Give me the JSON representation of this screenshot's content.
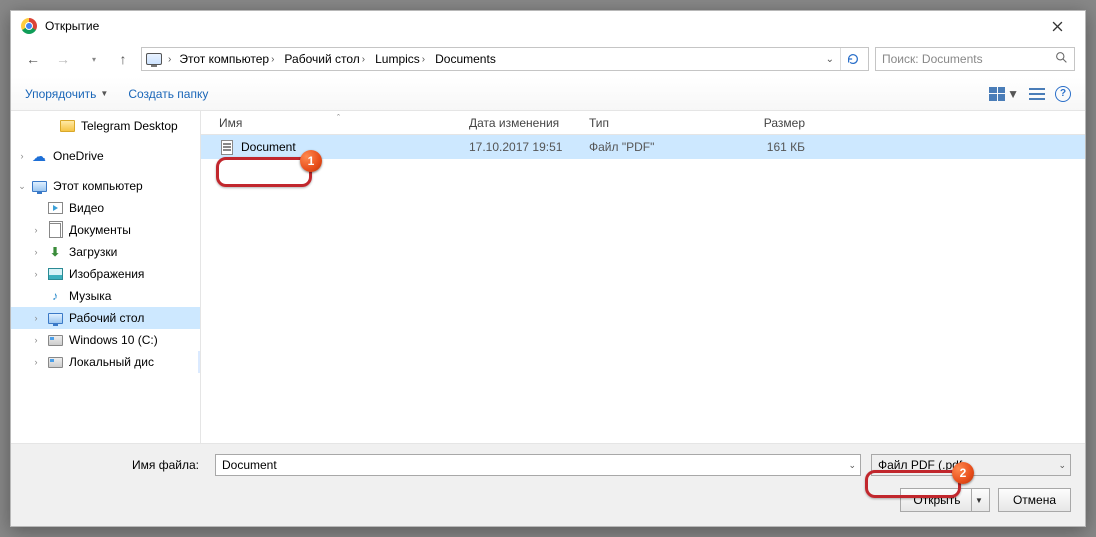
{
  "window": {
    "title": "Открытие"
  },
  "nav": {
    "crumbs": [
      "Этот компьютер",
      "Рабочий стол",
      "Lumpics",
      "Documents"
    ],
    "search_placeholder": "Поиск: Documents"
  },
  "toolbar": {
    "organize": "Упорядочить",
    "new_folder": "Создать папку"
  },
  "sidebar": {
    "items": [
      {
        "label": "Telegram Desktop",
        "kind": "folder",
        "level": 2
      },
      {
        "label": "OneDrive",
        "kind": "onedrive",
        "level": 0,
        "twisty": ">"
      },
      {
        "label": "Этот компьютер",
        "kind": "pc",
        "level": 0,
        "twisty": "v"
      },
      {
        "label": "Видео",
        "kind": "video",
        "level": 1
      },
      {
        "label": "Документы",
        "kind": "docs",
        "level": 1,
        "twisty": ">"
      },
      {
        "label": "Загрузки",
        "kind": "dl",
        "level": 1,
        "twisty": ">"
      },
      {
        "label": "Изображения",
        "kind": "img",
        "level": 1,
        "twisty": ">"
      },
      {
        "label": "Музыка",
        "kind": "music",
        "level": 1
      },
      {
        "label": "Рабочий стол",
        "kind": "monitor",
        "level": 1,
        "twisty": ">",
        "selected": true
      },
      {
        "label": "Windows 10 (C:)",
        "kind": "disk",
        "level": 1,
        "twisty": ">"
      },
      {
        "label": "Локальный дис",
        "kind": "disk",
        "level": 1,
        "twisty": ">"
      }
    ]
  },
  "columns": {
    "name": "Имя",
    "date": "Дата изменения",
    "type": "Тип",
    "size": "Размер"
  },
  "files": [
    {
      "name": "Document",
      "date": "17.10.2017 19:51",
      "type": "Файл \"PDF\"",
      "size": "161 КБ"
    }
  ],
  "footer": {
    "filename_label": "Имя файла:",
    "filename_value": "Document",
    "filter_label": "Файл PDF (.pdf",
    "open": "Открыть",
    "cancel": "Отмена"
  },
  "callouts": {
    "one": "1",
    "two": "2"
  }
}
